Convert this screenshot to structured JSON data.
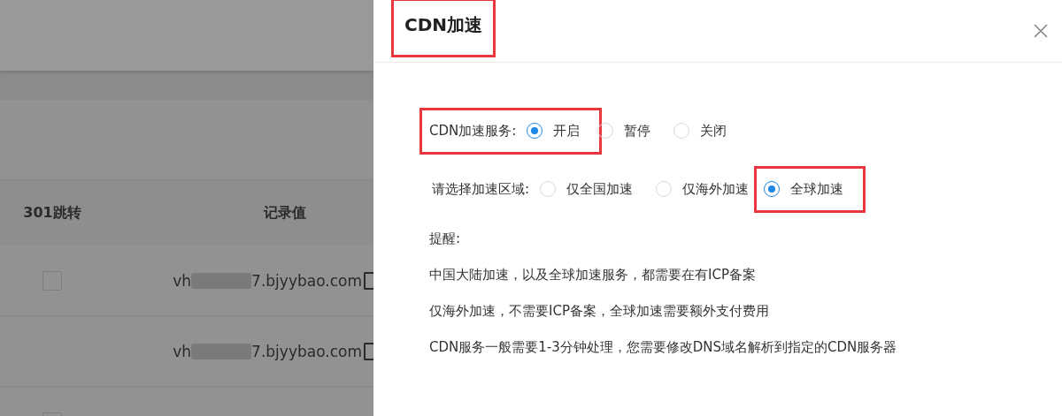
{
  "table": {
    "columns": [
      "301跳转",
      "记录值"
    ],
    "rows": [
      {
        "redirect": {
          "checked": false
        },
        "value": {
          "prefix": "vh",
          "suffix": "7.bjyybao.com"
        }
      },
      {
        "value": {
          "prefix": "vh",
          "suffix": "7.bjyybao.com"
        }
      },
      {
        "redirect": {
          "checked": false
        }
      }
    ]
  },
  "drawer": {
    "title": "CDN加速",
    "title_highlighted": true,
    "fields": [
      {
        "label": "CDN加速服务:",
        "highlighted": true,
        "options": [
          {
            "label": "开启",
            "selected": true,
            "highlighted": true
          },
          {
            "label": "暂停",
            "selected": false,
            "highlighted": false
          },
          {
            "label": "关闭",
            "selected": false,
            "highlighted": false
          }
        ]
      },
      {
        "label": "请选择加速区域:",
        "highlighted": false,
        "options": [
          {
            "label": "仅全国加速",
            "selected": false,
            "highlighted": false
          },
          {
            "label": "仅海外加速",
            "selected": false,
            "highlighted": false
          },
          {
            "label": "全球加速",
            "selected": true,
            "highlighted": true
          }
        ]
      }
    ],
    "notice_title": "提醒:",
    "notices": [
      "中国大陆加速，以及全球加速服务，都需要在有ICP备案",
      "仅海外加速，不需要ICP备案，全球加速需要额外支付费用",
      "CDN服务一般需要1-3分钟处理，您需要修改DNS域名解析到指定的CDN服务器"
    ]
  }
}
